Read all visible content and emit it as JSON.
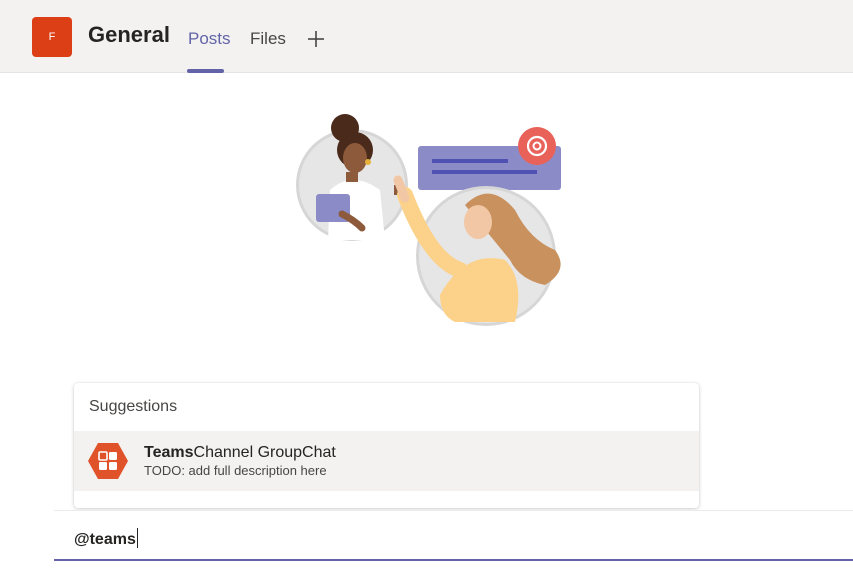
{
  "header": {
    "team_initial": "F",
    "channel_title": "General",
    "tabs": [
      {
        "label": "Posts",
        "active": true
      },
      {
        "label": "Files",
        "active": false
      }
    ],
    "add_tab_icon": "plus-icon"
  },
  "illustration": {
    "icons": [
      "person-with-tablet-icon",
      "person-waving-icon",
      "message-bubble-icon",
      "at-mention-icon"
    ]
  },
  "suggestions": {
    "header": "Suggestions",
    "items": [
      {
        "title_match": "Teams",
        "title_rest": "Channel GroupChat",
        "description": "TODO: add full description here",
        "icon": "app-hexagon-icon"
      }
    ]
  },
  "compose": {
    "value": "@teams"
  },
  "colors": {
    "accent": "#6264a7",
    "team_avatar": "#dc3e15",
    "app_icon": "#e0532a",
    "header_bg": "#f3f2f1"
  }
}
